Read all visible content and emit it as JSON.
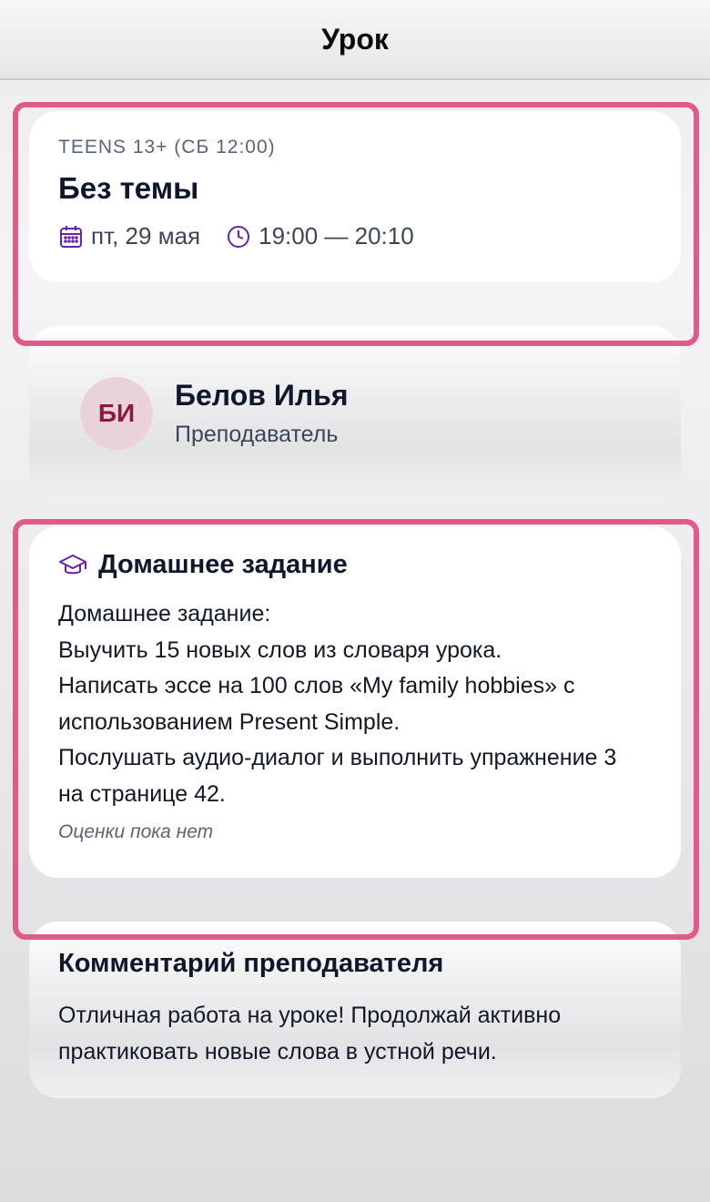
{
  "header": {
    "title": "Урок"
  },
  "lesson": {
    "group": "TEENS 13+ (СБ 12:00)",
    "title": "Без темы",
    "date": "пт, 29 мая",
    "time": "19:00 — 20:10",
    "date_icon": "calendar-icon",
    "time_icon": "clock-icon"
  },
  "teacher": {
    "initials": "БИ",
    "name": "Белов Илья",
    "role": "Преподаватель"
  },
  "homework": {
    "icon": "graduation-cap-icon",
    "title": "Домашнее задание",
    "lines": [
      "Домашнее задание:",
      "Выучить 15 новых слов из словаря урока.",
      "Написать эссе на 100 слов «My family hobbies» с",
      "использованием Present Simple.",
      "Послушать аудио-диалог и выполнить упражнение 3",
      "на странице 42."
    ],
    "grade": "Оценки пока нет"
  },
  "comment": {
    "title": "Комментарий преподавателя",
    "lines": [
      "Отличная работа на уроке! Продолжай активно",
      "практиковать новые слова в устной речи."
    ]
  },
  "colors": {
    "accent": "#6b21a8",
    "highlight": "#e05a8c",
    "avatar_bg": "#ead2dc",
    "avatar_text": "#8a1a3c"
  }
}
